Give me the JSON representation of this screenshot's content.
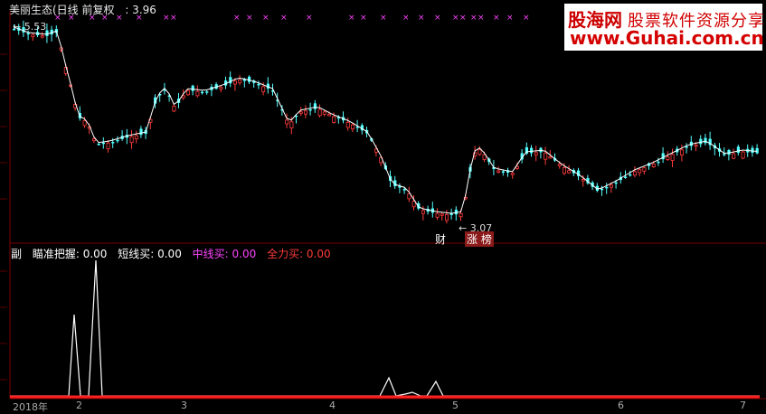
{
  "header": {
    "stock_title": "美丽生态(日线 前复权",
    "last_value": ": 3.96"
  },
  "watermark": {
    "cn_name": "股海网",
    "cn_sub": "股票软件资源分享",
    "url": "www.Guhai.com.cn"
  },
  "main_chart": {
    "high_label": "5.53",
    "low_label": "3.07",
    "events": {
      "cai": "财",
      "zhangting": "涨 榜"
    },
    "colors": {
      "up": "#ff3b3b",
      "down": "#54ffff",
      "ma": "#ffffff",
      "marker": "#ff44ff"
    }
  },
  "indicator": {
    "prefix": "副",
    "items": [
      {
        "label": "瞄准把握: 0.00",
        "color": "#ffffff"
      },
      {
        "label": "短线买: 0.00",
        "color": "#ffffff"
      },
      {
        "label": "中线买: 0.00",
        "color": "#ff44ff"
      },
      {
        "label": "全力买: 0.00",
        "color": "#ff3b3b"
      }
    ]
  },
  "xaxis": {
    "labels": [
      "2018年",
      "2",
      "3",
      "4",
      "5",
      "6",
      "7"
    ]
  }
}
